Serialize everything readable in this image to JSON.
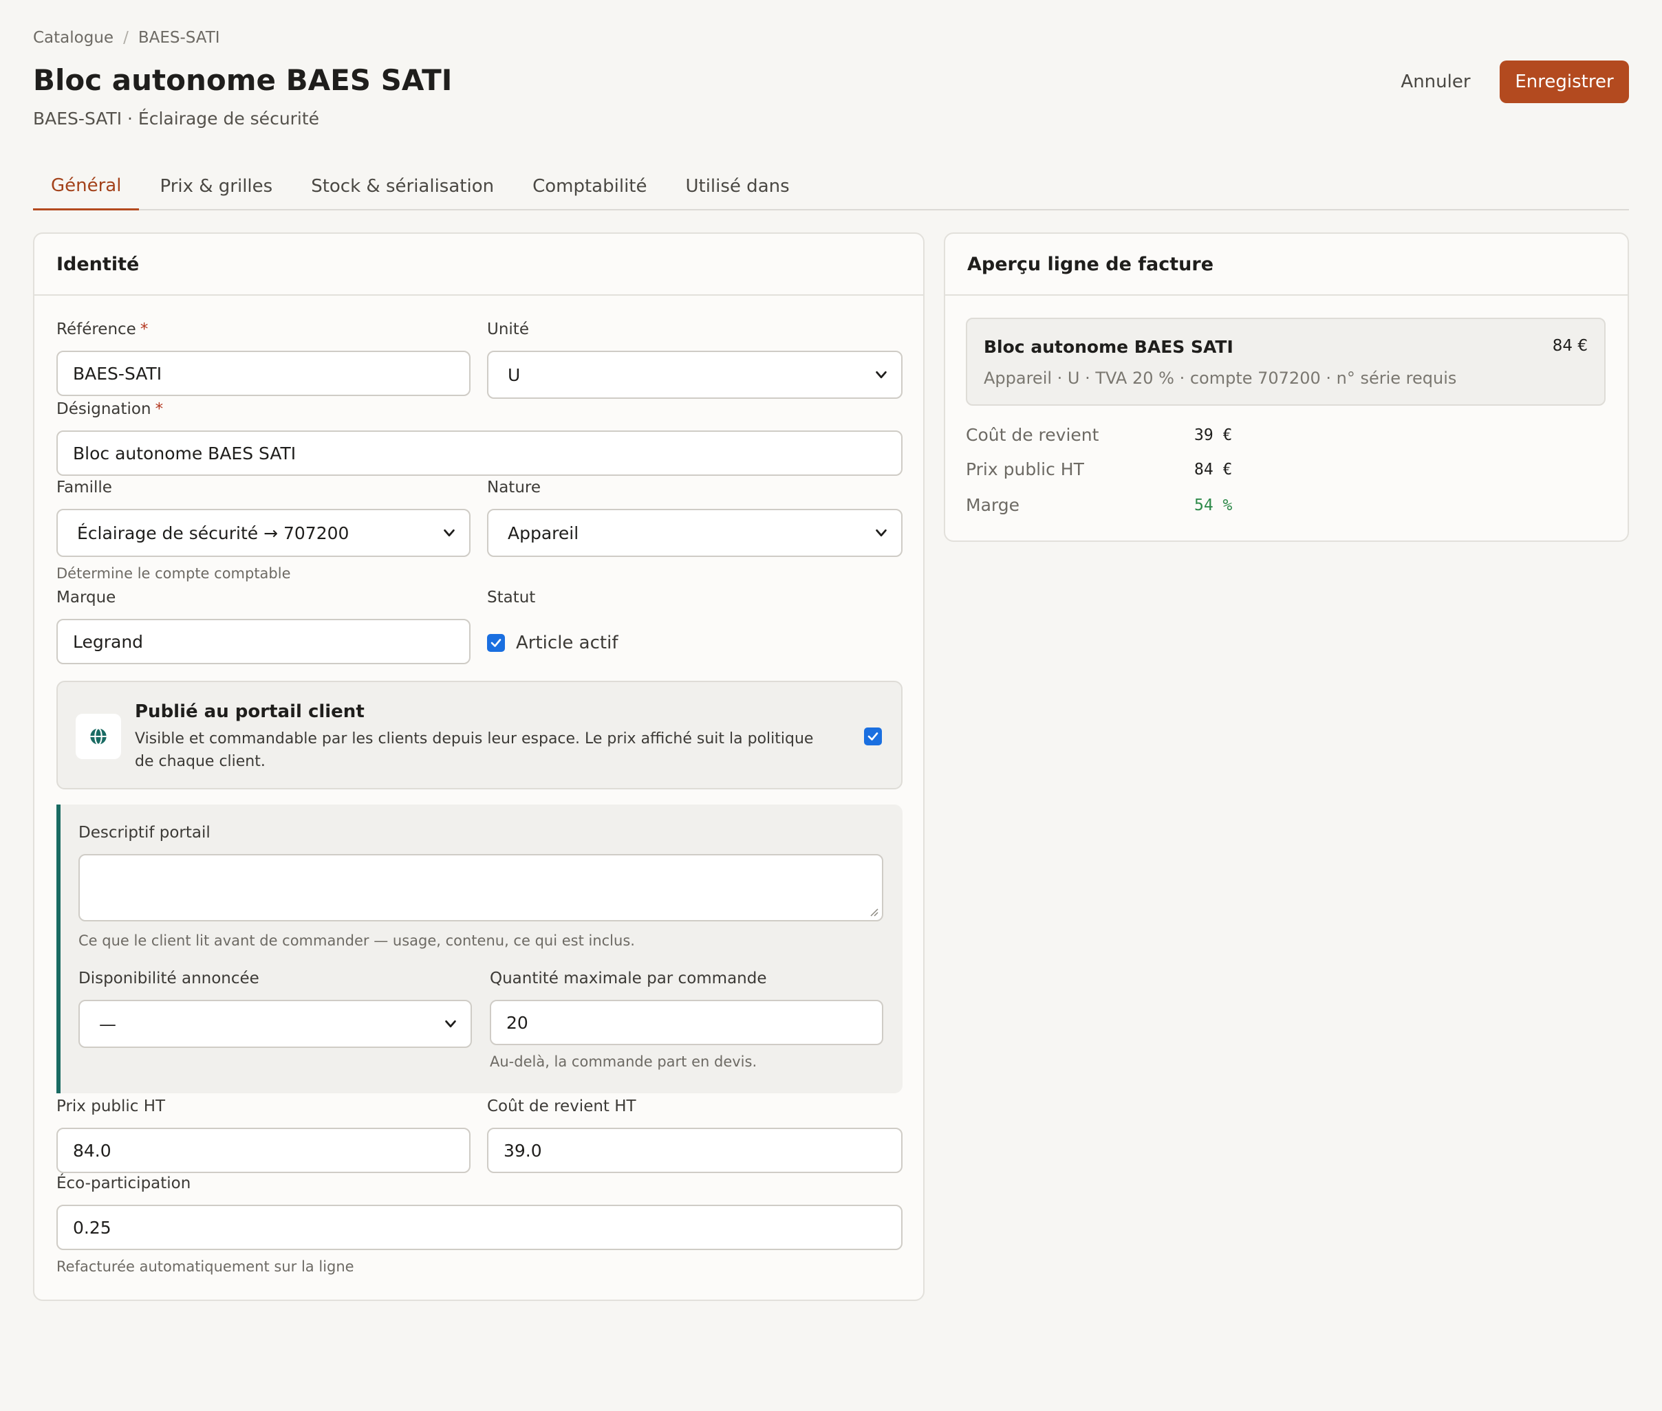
{
  "breadcrumb": {
    "root": "Catalogue",
    "separator": "/",
    "current": "BAES-SATI"
  },
  "header": {
    "title": "Bloc autonome BAES SATI",
    "subtitle": "BAES-SATI · Éclairage de sécurité",
    "cancel_label": "Annuler",
    "save_label": "Enregistrer"
  },
  "tabs": [
    {
      "label": "Général",
      "active": true
    },
    {
      "label": "Prix & grilles"
    },
    {
      "label": "Stock & sérialisation"
    },
    {
      "label": "Comptabilité"
    },
    {
      "label": "Utilisé dans"
    }
  ],
  "identity": {
    "title": "Identité",
    "reference": {
      "label": "Référence",
      "required_mark": "*",
      "value": "BAES-SATI"
    },
    "unit": {
      "label": "Unité",
      "value": "U"
    },
    "designation": {
      "label": "Désignation",
      "required_mark": "*",
      "value": "Bloc autonome BAES SATI"
    },
    "family": {
      "label": "Famille",
      "value": "Éclairage de sécurité → 707200",
      "hint": "Détermine le compte comptable"
    },
    "nature": {
      "label": "Nature",
      "value": "Appareil"
    },
    "brand": {
      "label": "Marque",
      "value": "Legrand"
    },
    "status": {
      "label": "Statut",
      "checkbox_label": "Article actif",
      "checked": true
    },
    "portal": {
      "title": "Publié au portail client",
      "description": "Visible et commandable par les clients depuis leur espace. Le prix affiché suit la politique de chaque client.",
      "checked": true,
      "icon": "globe-icon"
    },
    "portal_description": {
      "label": "Descriptif portail",
      "value": "",
      "hint": "Ce que le client lit avant de commander — usage, contenu, ce qui est inclus."
    },
    "availability": {
      "label": "Disponibilité annoncée",
      "value": "—"
    },
    "max_quantity": {
      "label": "Quantité maximale par commande",
      "value": "20",
      "hint": "Au-delà, la commande part en devis."
    },
    "public_price": {
      "label": "Prix public HT",
      "value": "84.0"
    },
    "cost_price": {
      "label": "Coût de revient HT",
      "value": "39.0"
    },
    "eco": {
      "label": "Éco-participation",
      "value": "0.25",
      "hint": "Refacturée automatiquement sur la ligne"
    }
  },
  "preview": {
    "title": "Aperçu ligne de facture",
    "line_name": "Bloc autonome BAES SATI",
    "line_price": "84 €",
    "line_meta": "Appareil · U · TVA 20 % · compte 707200 · n° série requis",
    "stats": [
      {
        "label": "Coût de revient",
        "value": "39 €"
      },
      {
        "label": "Prix public HT",
        "value": "84 €"
      },
      {
        "label": "Marge",
        "value": "54 %"
      }
    ]
  },
  "colors": {
    "accent": "#b34a1f",
    "teal": "#1a6b63",
    "checkbox": "#1a6fe0",
    "positive": "#2f8a4a"
  }
}
